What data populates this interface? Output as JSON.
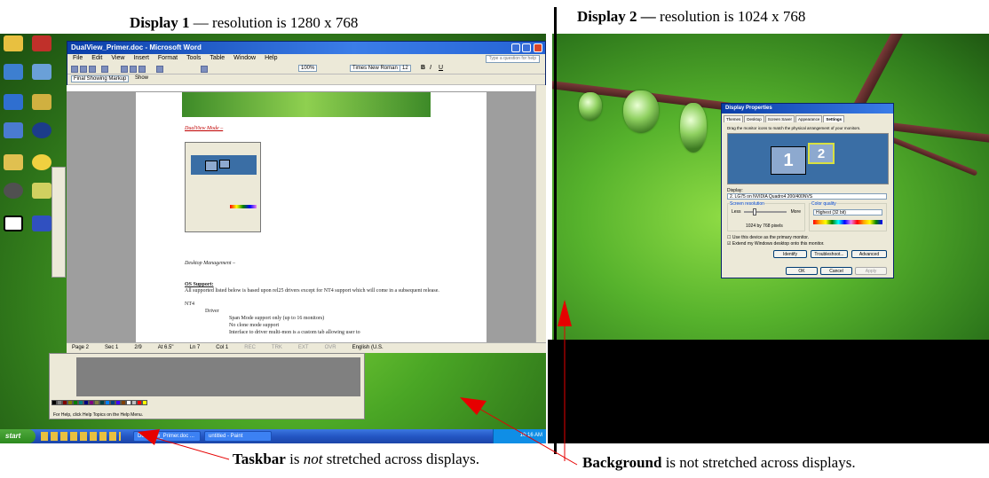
{
  "captions": {
    "display1": {
      "bold": "Display 1",
      "rest": " — resolution is 1280 x 768"
    },
    "display2": {
      "bold": "Display 2 —",
      "rest": " resolution is 1024 x 768"
    },
    "taskbar": {
      "bold": "Taskbar",
      "mid": " is ",
      "em": "not",
      "rest": " stretched across displays."
    },
    "background": {
      "bold": "Background",
      "rest": " is not stretched across displays."
    }
  },
  "word_window": {
    "title": "DualView_Primer.doc - Microsoft Word",
    "menu": [
      "File",
      "Edit",
      "View",
      "Insert",
      "Format",
      "Tools",
      "Table",
      "Window",
      "Help"
    ],
    "help_box": "Type a question for help",
    "font_name": "Times New Roman",
    "font_size": "12",
    "zoom": "100%",
    "markup": "Final Showing Markup",
    "show": "Show",
    "page": {
      "heading1": "DualView Mode –",
      "heading2": "Desktop Management –",
      "os_support": "OS Support:",
      "para": "All supported listed below is based upon rel25 drivers except for NT4 support which will come in a subsequent release.",
      "nt4": "NT4",
      "bullet_drivers": "Driver",
      "sub_items": [
        "Span Mode support only (up to 16 monitors)",
        "No clone mode support",
        "Interface to driver multi-mon is a custom tab allowing user to"
      ]
    },
    "status": [
      "Page 2",
      "Sec 1",
      "2/9",
      "At 6.5\"",
      "Ln 7",
      "Col 1",
      "REC",
      "TRK",
      "EXT",
      "OVR",
      "English (U.S."
    ]
  },
  "paint_window": {
    "status": "For Help, click Help Topics on the Help Menu."
  },
  "taskbar": {
    "start": "start",
    "tasks": [
      "DualView_Primer.doc ...",
      "untitled - Paint"
    ],
    "clock": "10:16 AM"
  },
  "display_dialog": {
    "title": "Display Properties",
    "tabs": [
      "Themes",
      "Desktop",
      "Screen Saver",
      "Appearance",
      "Settings"
    ],
    "active_tab": "Settings",
    "instruction": "Drag the monitor icons to match the physical arrangement of your monitors.",
    "monitor1": "1",
    "monitor2": "2",
    "display_label": "Display:",
    "display_value": "2. LG75 on NVIDIA Quadro4 200/400NVS",
    "resolution_label": "Screen resolution",
    "less": "Less",
    "more": "More",
    "resolution_value": "1024 by 768 pixels",
    "color_label": "Color quality",
    "color_value": "Highest (32 bit)",
    "check1": "Use this device as the primary monitor.",
    "check2": "Extend my Windows desktop onto this monitor.",
    "buttons": [
      "Identify",
      "Troubleshoot...",
      "Advanced"
    ],
    "ok": "OK",
    "cancel": "Cancel",
    "apply": "Apply"
  },
  "colors": {
    "accent_red": "#e60000",
    "xp_blue": "#2456c4",
    "xp_green": "#2c8a1e"
  }
}
